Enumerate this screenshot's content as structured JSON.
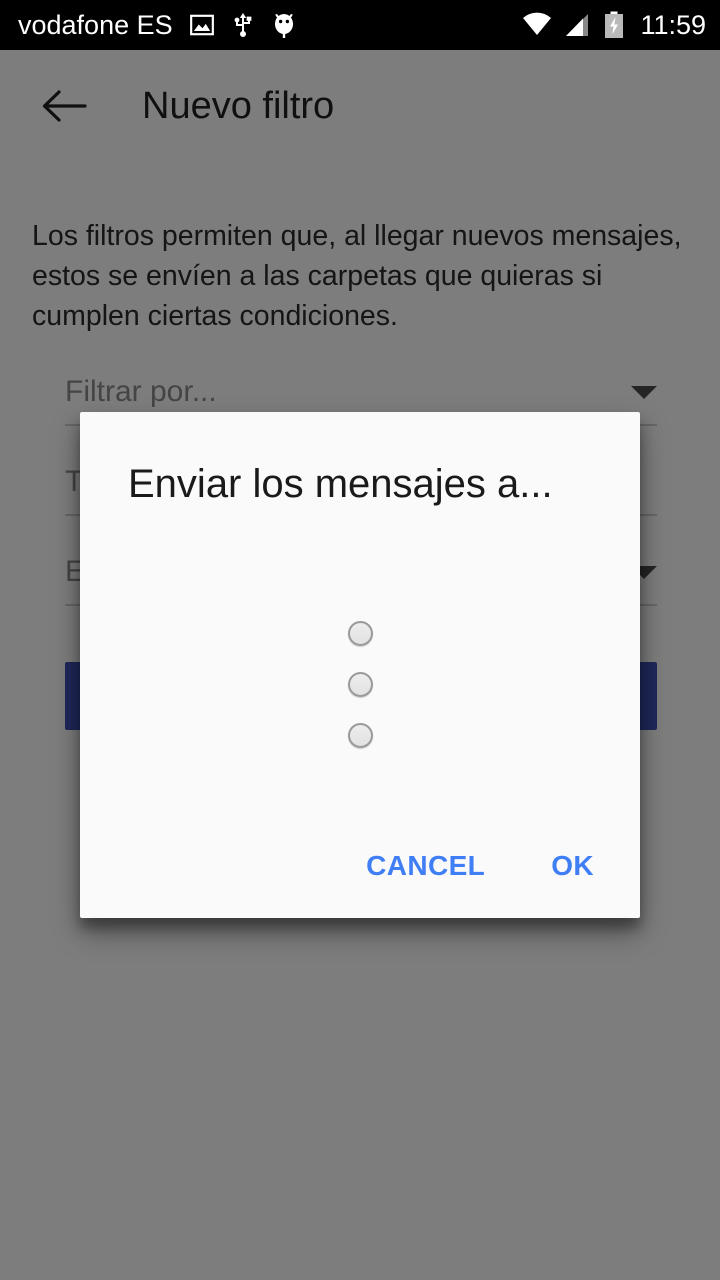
{
  "status_bar": {
    "carrier": "vodafone ES",
    "clock": "11:59",
    "icons_left": [
      "image-icon",
      "usb-icon",
      "android-debug-icon"
    ],
    "icons_right": [
      "wifi-icon",
      "cellular-signal-icon",
      "battery-charging-icon"
    ],
    "background_color": "#000000",
    "text_color": "#ffffff"
  },
  "app_bar": {
    "back_icon": "back-arrow-icon",
    "title": "Nuevo filtro"
  },
  "main": {
    "description": "Los filtros permiten que, al llegar nuevos mensajes, estos se envíen a las carpetas que quieras si cumplen ciertas condiciones.",
    "fields": [
      {
        "label": "Filtrar por...",
        "type": "spinner",
        "has_caret": true
      },
      {
        "label": "T",
        "type": "text",
        "has_caret": false
      },
      {
        "label": "E",
        "type": "spinner",
        "has_caret": true
      }
    ],
    "save_button_label": "",
    "save_button_color": "#3f51b5"
  },
  "dialog": {
    "title": "Enviar los mensajes a...",
    "options": [
      {
        "label": "",
        "selected": false
      },
      {
        "label": "",
        "selected": false
      },
      {
        "label": "",
        "selected": false
      }
    ],
    "cancel_label": "CANCEL",
    "ok_label": "OK",
    "accent_color": "#3f7ef5",
    "background_color": "#fafafa"
  },
  "scrim": {
    "color": "#000000",
    "opacity": "0.5"
  }
}
